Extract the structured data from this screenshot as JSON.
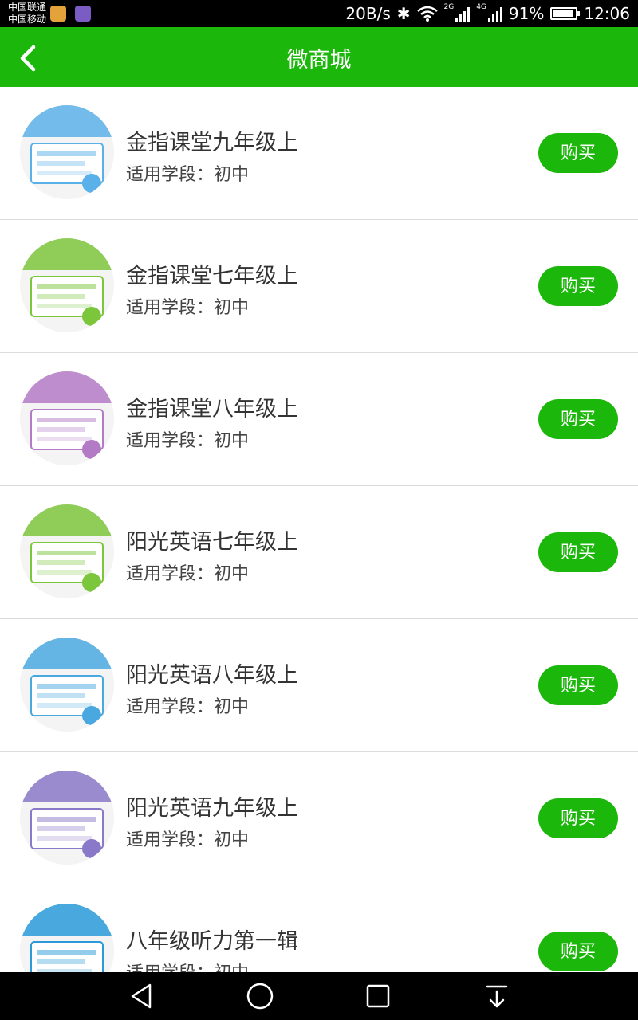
{
  "status_bar": {
    "carrier_1": "中国联通",
    "carrier_2": "中国移动",
    "speed": "20B/s",
    "net_2g": "2G",
    "net_4g": "4G",
    "battery_text": "91%",
    "battery_level": 0.91,
    "time": "12:06"
  },
  "header": {
    "title": "微商城"
  },
  "items": [
    {
      "title": "金指课堂九年级上",
      "stage": "适用学段：初中",
      "buy_label": "购买",
      "thumb_color": "#5ab0e8"
    },
    {
      "title": "金指课堂七年级上",
      "stage": "适用学段：初中",
      "buy_label": "购买",
      "thumb_color": "#7cc63c"
    },
    {
      "title": "金指课堂八年级上",
      "stage": "适用学段：初中",
      "buy_label": "购买",
      "thumb_color": "#b37ac6"
    },
    {
      "title": "阳光英语七年级上",
      "stage": "适用学段：初中",
      "buy_label": "购买",
      "thumb_color": "#7cc63c"
    },
    {
      "title": "阳光英语八年级上",
      "stage": "适用学段：初中",
      "buy_label": "购买",
      "thumb_color": "#4aa8e0"
    },
    {
      "title": "阳光英语九年级上",
      "stage": "适用学段：初中",
      "buy_label": "购买",
      "thumb_color": "#8a78c8"
    },
    {
      "title": "八年级听力第一辑",
      "stage": "适用学段：初中",
      "buy_label": "购买",
      "thumb_color": "#2a9ad8"
    }
  ],
  "colors": {
    "brand_green": "#1bb70a",
    "divider": "#dcdcdc"
  },
  "icons": {
    "back": "back-arrow-icon",
    "nav_back": "triangle-back-icon",
    "nav_home": "circle-home-icon",
    "nav_recent": "square-recent-icon",
    "nav_notify": "pull-down-icon"
  }
}
